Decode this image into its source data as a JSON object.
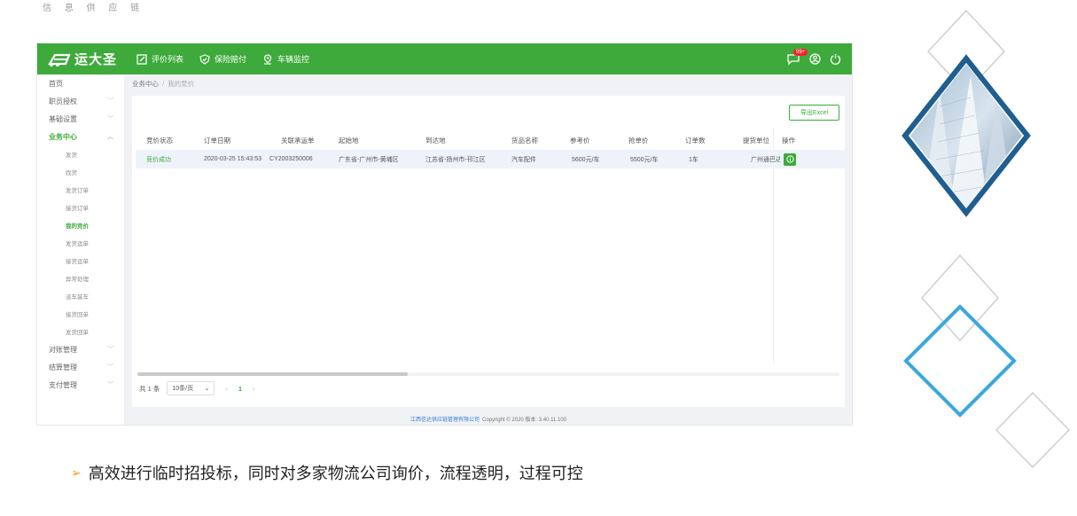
{
  "top_text": "信 息 供 应 链",
  "app": {
    "brand": "运大圣",
    "nav": [
      {
        "label": "评价列表",
        "icon": "edit-icon"
      },
      {
        "label": "保险赔付",
        "icon": "shield-check-icon"
      },
      {
        "label": "车辆监控",
        "icon": "location-pin-icon"
      }
    ],
    "badge_count": "99+",
    "sidebar": {
      "top_items": [
        {
          "label": "首页",
          "chevron": ""
        },
        {
          "label": "职员授权",
          "chevron": "﹀"
        },
        {
          "label": "基础设置",
          "chevron": "﹀"
        }
      ],
      "active_group": {
        "label": "业务中心",
        "chevron": "︿"
      },
      "sub_items": [
        "发货",
        "找货",
        "发货订单",
        "接货订单",
        "我的竞价",
        "发货运单",
        "接货运单",
        "异常处理",
        "派车装车",
        "接货回单",
        "发货回单"
      ],
      "active_sub_index": 4,
      "bottom_items": [
        {
          "label": "对账管理",
          "chevron": "﹀"
        },
        {
          "label": "结算管理",
          "chevron": "﹀"
        },
        {
          "label": "支付管理",
          "chevron": "﹀"
        }
      ]
    },
    "breadcrumb": {
      "root": "业务中心",
      "sep": "/",
      "current": "我的竞价"
    },
    "export_label": "导出Excel",
    "table": {
      "columns": [
        "竞价状态",
        "订单日期",
        "关联承运单",
        "起始地",
        "到达地",
        "货品名称",
        "参考价",
        "抢单价",
        "订单数",
        "提货单位",
        "操作"
      ],
      "rows": [
        [
          "竞价成功",
          "2020-03-25 15:43:53",
          "CY2003250006",
          "广东省-广州市-黄埔区",
          "江苏省-扬州市-邗江区",
          "汽车配件",
          "5600元/车",
          "5500元/车",
          "1车",
          "广州通巴达"
        ]
      ]
    },
    "pager": {
      "total": "共 1 条",
      "size": "10条/页",
      "size_caret": "⌄",
      "prev": "‹",
      "page": "1",
      "next": "›"
    },
    "footer": {
      "company": "江西信达供应链管理有限公司",
      "copyright": "Copyright © 2020 版本: 3.40.11.100"
    }
  },
  "caption": {
    "arrow": "➢",
    "text": "高效进行临时招投标，同时对多家物流公司询价，流程透明，过程可控"
  },
  "colors": {
    "brand_green": "#3daa3b",
    "dark_blue": "#1f5e8f",
    "light_blue": "#3aa8db",
    "orange_arrow": "#e8a21a"
  }
}
